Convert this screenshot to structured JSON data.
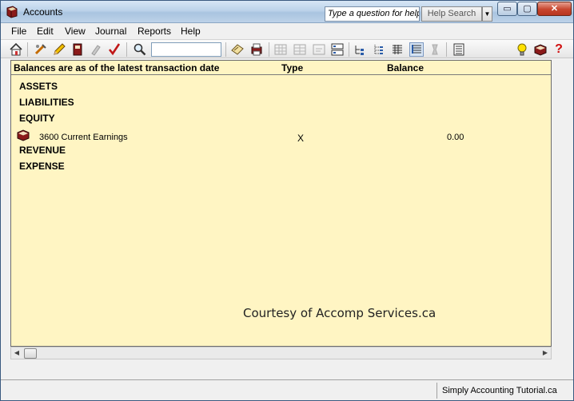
{
  "window": {
    "title": "Accounts",
    "question_placeholder": "Type a question for help",
    "help_search_label": "Help Search",
    "minimize_glyph": "▭",
    "maximize_glyph": "▢",
    "close_glyph": "✕"
  },
  "menu": {
    "items": [
      "File",
      "Edit",
      "View",
      "Journal",
      "Reports",
      "Help"
    ]
  },
  "toolbar": {
    "icons": [
      "home-icon",
      "modify-account-icon",
      "edit-pencil-icon",
      "journal-book-icon",
      "remove-icon",
      "check-icon",
      "search-icon",
      "find-input",
      "notes-icon",
      "print-icon",
      "icon-view-1",
      "icon-view-2",
      "icon-view-3",
      "icon-view-4",
      "small-icons-view",
      "tree-view-icon",
      "list-view-icon",
      "detail-view-icon",
      "disabled-icon",
      "report-icon",
      "tip-icon",
      "help-book-icon",
      "help-question-icon"
    ]
  },
  "table": {
    "header": {
      "balances_note": "Balances are as of the latest transaction date",
      "type": "Type",
      "balance": "Balance"
    },
    "sections": [
      "ASSETS",
      "LIABILITIES",
      "EQUITY",
      "REVENUE",
      "EXPENSE"
    ],
    "rows": [
      {
        "account": "3600 Current Earnings",
        "type": "X",
        "balance": "0.00"
      }
    ]
  },
  "watermark": "Courtesy of Accomp Services.ca",
  "status": {
    "text": "Simply Accounting Tutorial.ca"
  },
  "colors": {
    "content_background": "#fff5c3",
    "close_button": "#c7452d",
    "title_bar": "#bcd3ea"
  }
}
